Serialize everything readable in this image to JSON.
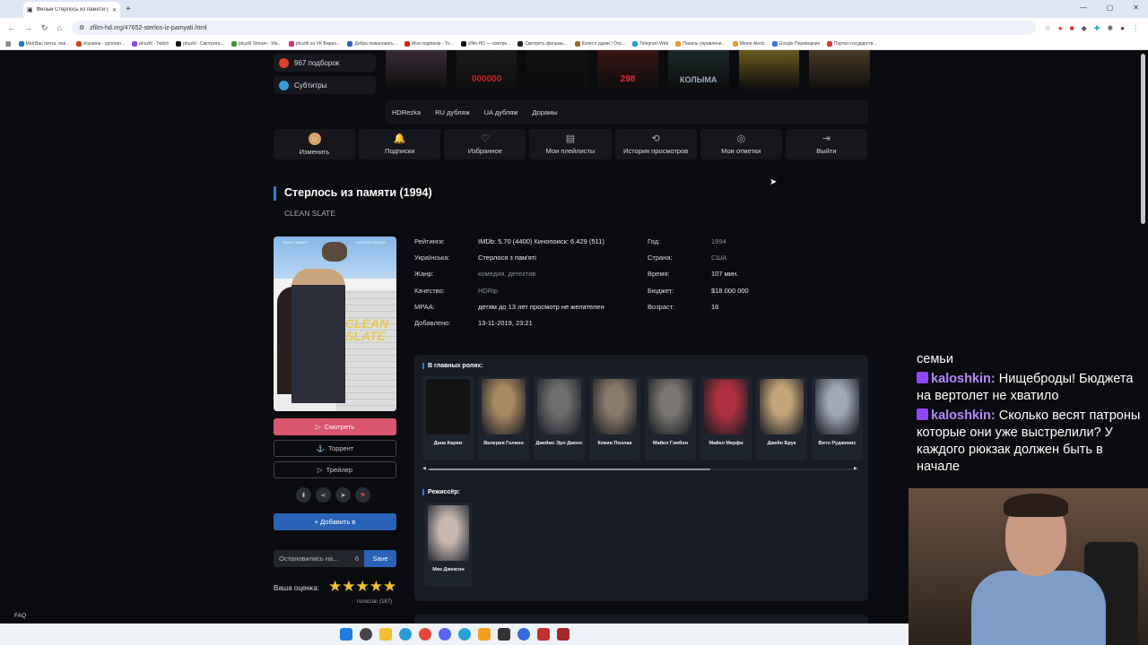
{
  "browser": {
    "tab_title": "Фильм Стерлось из памяти (1...",
    "url": "zfilm-hd.org/47652-sterlos-iz-pamyati.html",
    "new_tab": "+",
    "bookmarks": [
      {
        "label": "Mail.Вас почта, пои...",
        "color": "#1e7bd6"
      },
      {
        "label": "Корзина - igroman...",
        "color": "#d6421e"
      },
      {
        "label": "phuztil - Twitch",
        "color": "#9146ff"
      },
      {
        "label": "phuztil - Смотрите...",
        "color": "#111111"
      },
      {
        "label": "phuztil Stream - Wa...",
        "color": "#3a9c2f"
      },
      {
        "label": "phuztil на VK Видео...",
        "color": "#d6306e"
      },
      {
        "label": "Добро пожаловать...",
        "color": "#2a62b8"
      },
      {
        "label": "Мои подписки - Yo...",
        "color": "#e02020"
      },
      {
        "label": "zfilm-HD — смотре...",
        "color": "#111111"
      },
      {
        "label": "Смотреть фильмы...",
        "color": "#222222"
      },
      {
        "label": "Колесо удачи | Отр...",
        "color": "#9a6b2a"
      },
      {
        "label": "Telegram Web",
        "color": "#2aa1da"
      },
      {
        "label": "Панель управлени...",
        "color": "#e0a020"
      },
      {
        "label": "Meme Alerts",
        "color": "#f0a030"
      },
      {
        "label": "Google Переводчик",
        "color": "#3a7be0"
      },
      {
        "label": "Портал государств...",
        "color": "#d63a3a"
      }
    ]
  },
  "sidebar": {
    "collections": "967 подборок",
    "subtitles": "Субтитры"
  },
  "top_posters": [
    {
      "text": "",
      "color": "#3a2c38"
    },
    {
      "text": "000000",
      "color": "#1a1a1a"
    },
    {
      "text": "",
      "color": "#111111"
    },
    {
      "text": "298",
      "color": "#3a1414"
    },
    {
      "text": "КОЛЫМА",
      "color": "#1c2a2a"
    },
    {
      "text": "",
      "color": "#6a5a1e"
    },
    {
      "text": "",
      "color": "#4a3a24"
    }
  ],
  "translations": [
    "HDRezka",
    "RU дубляж",
    "UA дубляж",
    "Дорамы"
  ],
  "user_nav": [
    {
      "label": "Изменить",
      "icon": "avatar-icon"
    },
    {
      "label": "Подписки",
      "icon": "bell-icon"
    },
    {
      "label": "Избранное",
      "icon": "heart-icon"
    },
    {
      "label": "Мои плейлисты",
      "icon": "playlist-icon"
    },
    {
      "label": "История просмотров",
      "icon": "history-icon"
    },
    {
      "label": "Мои отметки",
      "icon": "play-circle-icon"
    },
    {
      "label": "Выйти",
      "icon": "logout-icon"
    }
  ],
  "film": {
    "title": "Стерлось из памяти (1994)",
    "original_title": "CLEAN SLATE",
    "poster": {
      "name_left": "DANA CARVEY",
      "name_right": "VALERIA GOLINO",
      "title": "CLEAN SLATE"
    }
  },
  "info_left": [
    {
      "key": "Рейтинги:",
      "value": "IMDb: 5.70 (4400) Кинопоиск: 6.429 (511)",
      "link": false
    },
    {
      "key": "Українська:",
      "value": "Стерлося з пам'яті",
      "link": false
    },
    {
      "key": "Жанр:",
      "value": "комедия, детектив",
      "link": true
    },
    {
      "key": "Качество:",
      "value": "HDRip",
      "link": true
    },
    {
      "key": "MPAA:",
      "value": "детям до 13 лет просмотр не желателен",
      "link": false
    },
    {
      "key": "Добавлено:",
      "value": "13-11-2019, 23:21",
      "link": false
    }
  ],
  "info_right": [
    {
      "key": "Год:",
      "value": "1994",
      "link": true
    },
    {
      "key": "Страна:",
      "value": "США",
      "link": true
    },
    {
      "key": "Время:",
      "value": "107 мин.",
      "link": false
    },
    {
      "key": "Бюджет:",
      "value": "$18 000 000",
      "link": false
    },
    {
      "key": "Возраст:",
      "value": "16",
      "link": false
    }
  ],
  "actions": {
    "watch": "Смотреть",
    "torrent": "Торрент",
    "trailer": "Трейлер",
    "add_to": "+ Добавить в",
    "stopped_placeholder": "Остановились на...",
    "stopped_value": "6",
    "save": "Save",
    "rating_label": "Ваша оценка:",
    "stars": "★★★★★",
    "votes": "голосов: (187)"
  },
  "cast": {
    "heading": "В главных ролях:",
    "actors": [
      {
        "name": "Дана Карви",
        "color": "#121212"
      },
      {
        "name": "Валерия Голино",
        "color": "#a98a62"
      },
      {
        "name": "Джеймс Эрл Джонс",
        "color": "#6e6e6e"
      },
      {
        "name": "Кевин Поллак",
        "color": "#8a7a6a"
      },
      {
        "name": "Майкл Гэмбон",
        "color": "#7a7670"
      },
      {
        "name": "Майкл Мерфи",
        "color": "#b03040"
      },
      {
        "name": "Джейн Брук",
        "color": "#c4a478"
      },
      {
        "name": "Вито Руджинис",
        "color": "#a0a8b8"
      }
    ],
    "director_heading": "Режиссёр:",
    "director": {
      "name": "Мик Джексон",
      "color": "#c8b8b0"
    }
  },
  "faq": "FAQ",
  "chat": [
    {
      "user": "",
      "text": "семьи"
    },
    {
      "user": "kaloshkin:",
      "text": "Нищеброды! Бюджета на вертолет не хватило"
    },
    {
      "user": "kaloshkin:",
      "text": "Сколько весят патроны которые они уже выстрелили? У каждого рюкзак должен быть в начале"
    }
  ]
}
